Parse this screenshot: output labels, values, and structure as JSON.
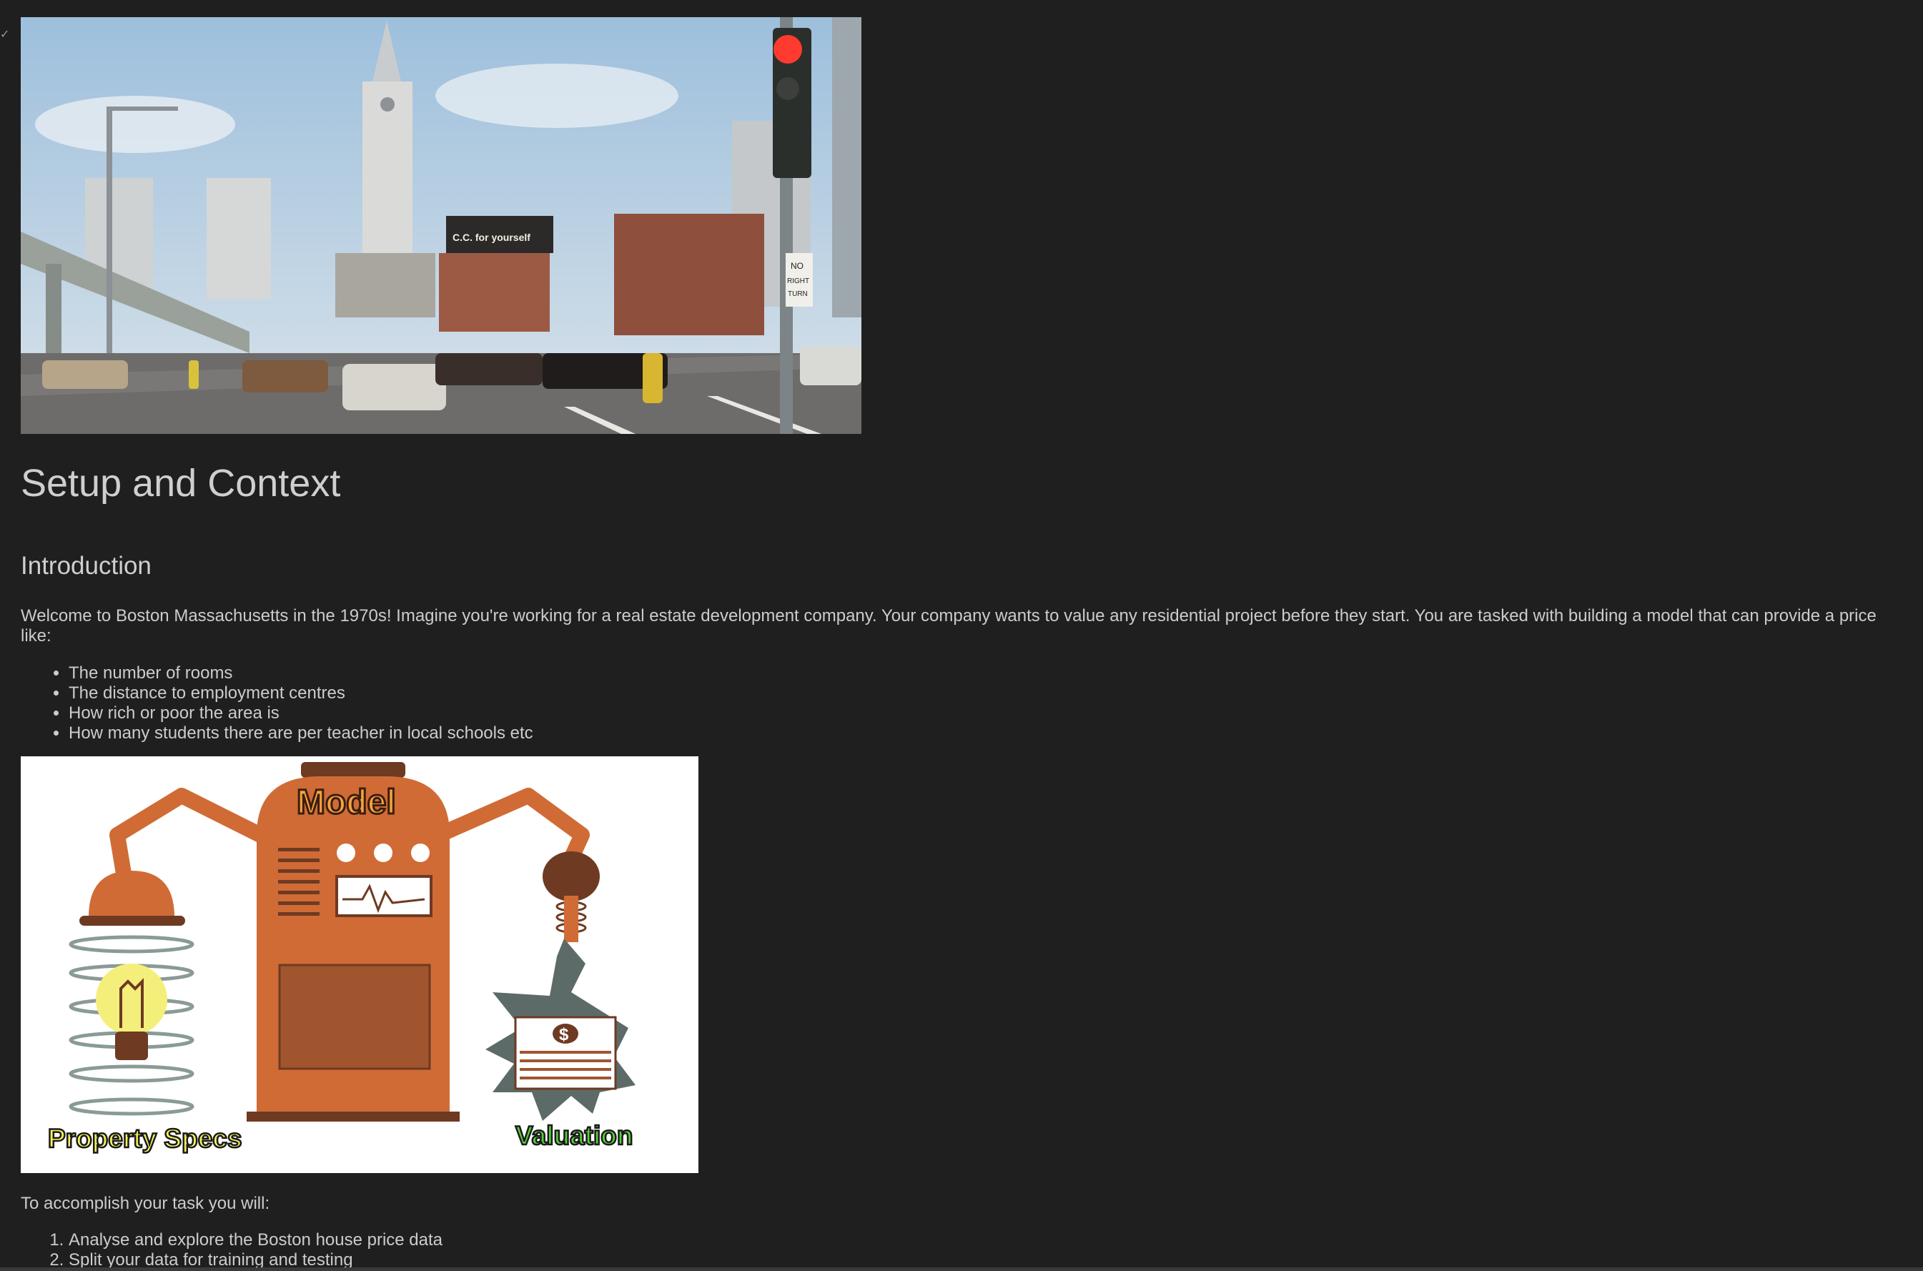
{
  "gutter": {
    "check_icon": "check-icon",
    "check_glyph": "✓"
  },
  "hero_image": {
    "billboard_text": "C.C. for yourself",
    "sign_line1": "NO",
    "sign_line2": "RIGHT",
    "sign_line3": "TURN"
  },
  "heading": {
    "title": "Setup and Context",
    "subtitle": "Introduction"
  },
  "intro": {
    "line1": "Welcome to Boston Massachusetts in the 1970s! Imagine you're working for a real estate development company. Your company wants to value any residential project before they start. You are tasked with building a model that can provide a price",
    "line2": "like:"
  },
  "bullets": [
    "The number of rooms",
    "The distance to employment centres",
    "How rich or poor the area is",
    "How many students there are per teacher in local schools etc"
  ],
  "diagram": {
    "model_label": "Model",
    "specs_label": "Property Specs",
    "valuation_label": "Valuation",
    "dollar_sign": "$",
    "colors": {
      "machine": "#d06b36",
      "dark_brown": "#6e3a22",
      "panel": "#a0552f",
      "burst": "#5d6b68",
      "bulb": "#f4ef7a",
      "specs_text": "#f4f25a",
      "valuation_text": "#59d13b"
    }
  },
  "task": {
    "intro": "To accomplish your task you will:",
    "steps": [
      "Analyse and explore the Boston house price data",
      "Split your data for training and testing"
    ]
  }
}
